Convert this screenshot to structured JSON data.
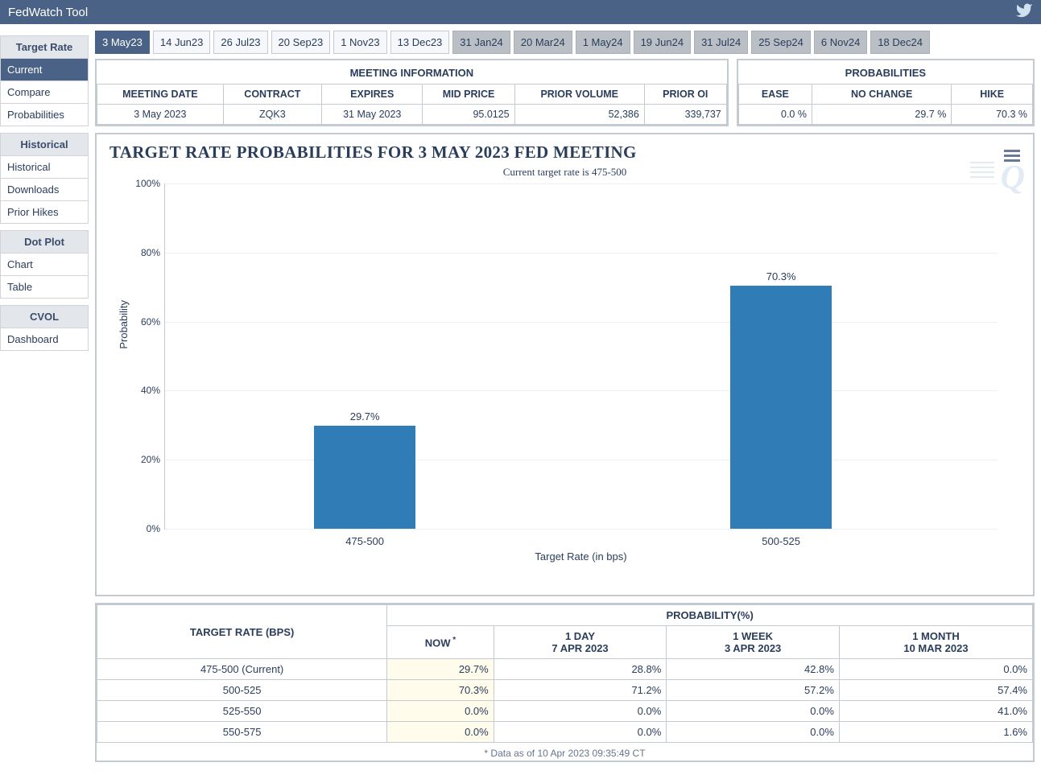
{
  "title": "FedWatch Tool",
  "sidebar": {
    "groups": [
      {
        "head": "Target Rate",
        "items": [
          "Current",
          "Compare",
          "Probabilities"
        ],
        "active_index": 0
      },
      {
        "head": "Historical",
        "items": [
          "Historical",
          "Downloads",
          "Prior Hikes"
        ]
      },
      {
        "head": "Dot Plot",
        "items": [
          "Chart",
          "Table"
        ]
      },
      {
        "head": "CVOL",
        "items": [
          "Dashboard"
        ]
      }
    ]
  },
  "tabs": [
    {
      "label": "3 May23",
      "active": true
    },
    {
      "label": "14 Jun23"
    },
    {
      "label": "26 Jul23"
    },
    {
      "label": "20 Sep23"
    },
    {
      "label": "1 Nov23"
    },
    {
      "label": "13 Dec23"
    },
    {
      "label": "31 Jan24",
      "muted": true
    },
    {
      "label": "20 Mar24",
      "muted": true
    },
    {
      "label": "1 May24",
      "muted": true
    },
    {
      "label": "19 Jun24",
      "muted": true
    },
    {
      "label": "31 Jul24",
      "muted": true
    },
    {
      "label": "25 Sep24",
      "muted": true
    },
    {
      "label": "6 Nov24",
      "muted": true
    },
    {
      "label": "18 Dec24",
      "muted": true
    }
  ],
  "meeting_info": {
    "title": "MEETING INFORMATION",
    "headers": [
      "MEETING DATE",
      "CONTRACT",
      "EXPIRES",
      "MID PRICE",
      "PRIOR VOLUME",
      "PRIOR OI"
    ],
    "values": [
      "3 May 2023",
      "ZQK3",
      "31 May 2023",
      "95.0125",
      "52,386",
      "339,737"
    ]
  },
  "prob_summary": {
    "title": "PROBABILITIES",
    "headers": [
      "EASE",
      "NO CHANGE",
      "HIKE"
    ],
    "values": [
      "0.0 %",
      "29.7 %",
      "70.3 %"
    ]
  },
  "chart_data": {
    "type": "bar",
    "title": "TARGET RATE PROBABILITIES FOR 3 MAY 2023 FED MEETING",
    "subtitle": "Current target rate is 475-500",
    "ylabel": "Probability",
    "xlabel": "Target Rate (in bps)",
    "ylim": [
      0,
      100
    ],
    "yticks": [
      0,
      20,
      40,
      60,
      80,
      100
    ],
    "categories": [
      "475-500",
      "500-525"
    ],
    "values": [
      29.7,
      70.3
    ],
    "value_labels": [
      "29.7%",
      "70.3%"
    ]
  },
  "prob_table": {
    "head_target": "TARGET RATE (BPS)",
    "head_prob": "PROBABILITY(%)",
    "cols": [
      {
        "top": "NOW",
        "bottom": "",
        "star": true
      },
      {
        "top": "1 DAY",
        "bottom": "7 APR 2023"
      },
      {
        "top": "1 WEEK",
        "bottom": "3 APR 2023"
      },
      {
        "top": "1 MONTH",
        "bottom": "10 MAR 2023"
      }
    ],
    "rows": [
      {
        "label": "475-500 (Current)",
        "cells": [
          "29.7%",
          "28.8%",
          "42.8%",
          "0.0%"
        ]
      },
      {
        "label": "500-525",
        "cells": [
          "70.3%",
          "71.2%",
          "57.2%",
          "57.4%"
        ]
      },
      {
        "label": "525-550",
        "cells": [
          "0.0%",
          "0.0%",
          "0.0%",
          "41.0%"
        ]
      },
      {
        "label": "550-575",
        "cells": [
          "0.0%",
          "0.0%",
          "0.0%",
          "1.6%"
        ]
      }
    ]
  },
  "footnote": "* Data as of 10 Apr 2023 09:35:49 CT"
}
